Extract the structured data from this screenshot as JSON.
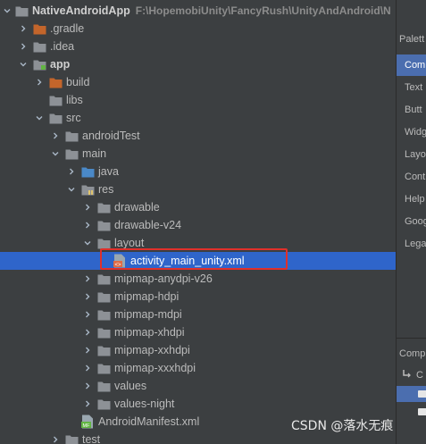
{
  "project_tree": {
    "root": {
      "name": "NativeAndroidApp",
      "path": "F:\\HopemobiUnity\\FancyRush\\UnityAndAndroid\\N"
    },
    "items": [
      {
        "label": ".gradle",
        "icon": "folder-orange",
        "expand": "collapsed"
      },
      {
        "label": ".idea",
        "icon": "folder",
        "expand": "collapsed"
      },
      {
        "label": "app",
        "icon": "module-folder",
        "expand": "expanded"
      },
      {
        "label": "build",
        "icon": "folder-orange",
        "expand": "collapsed"
      },
      {
        "label": "libs",
        "icon": "folder",
        "expand": "none"
      },
      {
        "label": "src",
        "icon": "folder",
        "expand": "expanded"
      },
      {
        "label": "androidTest",
        "icon": "folder",
        "expand": "collapsed"
      },
      {
        "label": "main",
        "icon": "folder",
        "expand": "expanded"
      },
      {
        "label": "java",
        "icon": "folder-blue",
        "expand": "collapsed"
      },
      {
        "label": "res",
        "icon": "res-folder",
        "expand": "expanded"
      },
      {
        "label": "drawable",
        "icon": "folder",
        "expand": "collapsed"
      },
      {
        "label": "drawable-v24",
        "icon": "folder",
        "expand": "collapsed"
      },
      {
        "label": "layout",
        "icon": "folder",
        "expand": "expanded"
      },
      {
        "label": "activity_main_unity.xml",
        "icon": "xml-file",
        "expand": "none"
      },
      {
        "label": "mipmap-anydpi-v26",
        "icon": "folder",
        "expand": "collapsed"
      },
      {
        "label": "mipmap-hdpi",
        "icon": "folder",
        "expand": "collapsed"
      },
      {
        "label": "mipmap-mdpi",
        "icon": "folder",
        "expand": "collapsed"
      },
      {
        "label": "mipmap-xhdpi",
        "icon": "folder",
        "expand": "collapsed"
      },
      {
        "label": "mipmap-xxhdpi",
        "icon": "folder",
        "expand": "collapsed"
      },
      {
        "label": "mipmap-xxxhdpi",
        "icon": "folder",
        "expand": "collapsed"
      },
      {
        "label": "values",
        "icon": "folder",
        "expand": "collapsed"
      },
      {
        "label": "values-night",
        "icon": "folder",
        "expand": "collapsed"
      },
      {
        "label": "AndroidManifest.xml",
        "icon": "manifest-file",
        "expand": "none"
      },
      {
        "label": "test",
        "icon": "folder",
        "expand": "collapsed"
      }
    ]
  },
  "palette": {
    "title": "Palett",
    "items": [
      "Com",
      "Text",
      "Butt",
      "Widg",
      "Layo",
      "Cont",
      "Help",
      "Goog",
      "Lega"
    ]
  },
  "component_tree": {
    "title": "Comp",
    "root_label": "C"
  },
  "watermark": "CSDN @落水无痕",
  "colors": {
    "selection": "#2f65ca",
    "highlight_box": "#e0302b",
    "folder": "#8d9196",
    "folder_excluded": "#c3652b",
    "folder_source": "#4a89c8"
  }
}
